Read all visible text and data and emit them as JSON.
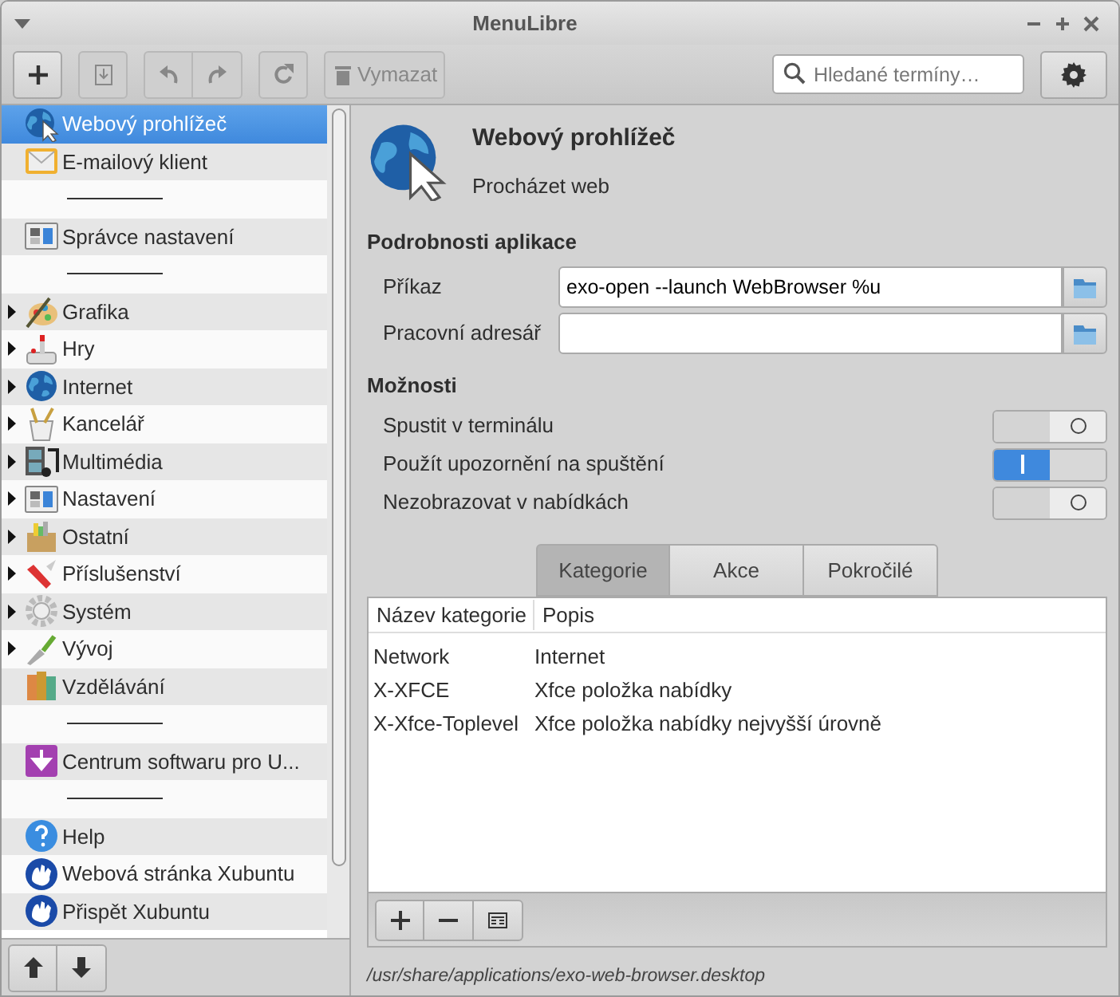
{
  "window": {
    "title": "MenuLibre"
  },
  "toolbar": {
    "buttons": [
      {
        "kind": "add",
        "disabled": false
      },
      {
        "kind": "save",
        "disabled": true
      },
      {
        "kind": "undo",
        "disabled": true
      },
      {
        "kind": "redo",
        "disabled": true
      },
      {
        "kind": "revert",
        "disabled": true
      },
      {
        "kind": "delete",
        "label": "Vymazat",
        "disabled": true
      }
    ],
    "search": {
      "placeholder": "Hledané termíny…"
    }
  },
  "sidebar": {
    "items": [
      {
        "kind": "app",
        "label": "Webový prohlížeč",
        "selected": true
      },
      {
        "kind": "app",
        "label": "E-mailový klient",
        "selected": false
      },
      {
        "kind": "separator"
      },
      {
        "kind": "app",
        "label": "Správce nastavení",
        "selected": false
      },
      {
        "kind": "separator"
      },
      {
        "kind": "directory",
        "label": "Grafika",
        "expanded": false,
        "selected": false
      },
      {
        "kind": "directory",
        "label": "Hry",
        "expanded": false,
        "selected": false
      },
      {
        "kind": "directory",
        "label": "Internet",
        "expanded": false,
        "selected": false
      },
      {
        "kind": "directory",
        "label": "Kancelář",
        "expanded": false,
        "selected": false
      },
      {
        "kind": "directory",
        "label": "Multimédia",
        "expanded": false,
        "selected": false
      },
      {
        "kind": "directory",
        "label": "Nastavení",
        "expanded": false,
        "selected": false
      },
      {
        "kind": "directory",
        "label": "Ostatní",
        "expanded": false,
        "selected": false
      },
      {
        "kind": "directory",
        "label": "Příslušenství",
        "expanded": false,
        "selected": false
      },
      {
        "kind": "directory",
        "label": "Systém",
        "expanded": false,
        "selected": false
      },
      {
        "kind": "directory",
        "label": "Vývoj",
        "expanded": false,
        "selected": false
      },
      {
        "kind": "app",
        "label": "Vzdělávání",
        "selected": false
      },
      {
        "kind": "separator"
      },
      {
        "kind": "app",
        "label": "Centrum softwaru pro U...",
        "selected": false
      },
      {
        "kind": "separator"
      },
      {
        "kind": "app",
        "label": "Help",
        "selected": false
      },
      {
        "kind": "app",
        "label": "Webová stránka Xubuntu",
        "selected": false
      },
      {
        "kind": "app",
        "label": "Přispět Xubuntu",
        "selected": false
      }
    ]
  },
  "app": {
    "name": "Webový prohlížeč",
    "comment": "Procházet web"
  },
  "details": {
    "heading": "Podrobnosti aplikace",
    "fields": [
      {
        "label": "Příkaz",
        "value": "exo-open --launch WebBrowser %u"
      },
      {
        "label": "Pracovní adresář"
      }
    ]
  },
  "options": {
    "heading": "Možnosti",
    "items": [
      {
        "label": "Spustit v terminálu",
        "on": false
      },
      {
        "label": "Použít upozornění na spuštění",
        "on": true
      },
      {
        "label": "Nezobrazovat v nabídkách",
        "on": false
      }
    ]
  },
  "tabs": [
    {
      "label": "Kategorie",
      "selected": true
    },
    {
      "label": "Akce",
      "selected": false
    },
    {
      "label": "Pokročilé",
      "selected": false
    }
  ],
  "table": {
    "columns": [
      "Název kategorie",
      "Popis"
    ],
    "rows": [
      [
        "Network",
        "Internet"
      ],
      [
        "X-XFCE",
        "Xfce položka nabídky"
      ],
      [
        "X-Xfce-Toplevel",
        "Xfce položka nabídky nejvyšší úrovně"
      ]
    ]
  },
  "status_bar": {
    "path": "/usr/share/applications/exo-web-browser.desktop"
  }
}
